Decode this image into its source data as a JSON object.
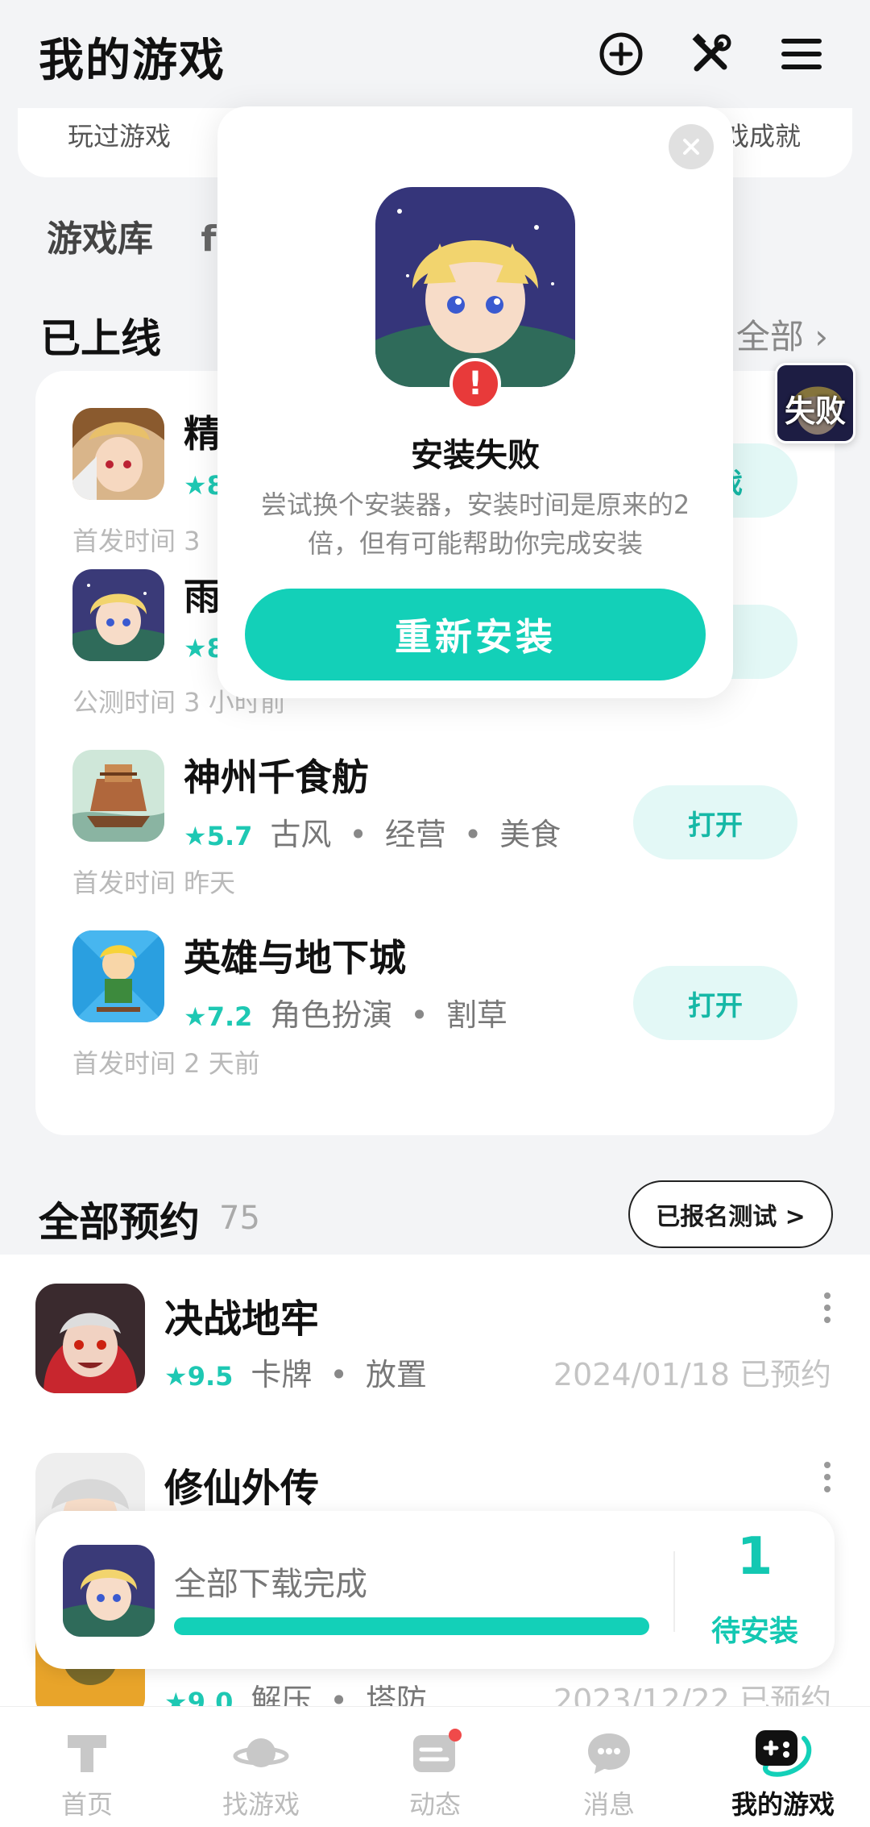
{
  "header": {
    "title": "我的游戏"
  },
  "stats": {
    "left": "玩过游戏",
    "right": "戏成就"
  },
  "tabs": {
    "label": "游戏库",
    "partial": "f"
  },
  "online": {
    "title": "已上线",
    "more": "全部",
    "games": [
      {
        "name": "精",
        "rating": "★8",
        "tags": [],
        "time": "首发时间 3 ",
        "button": "游戏"
      },
      {
        "name": "雨",
        "rating": "★8",
        "tags": [],
        "time": "公测时间 3 小时前",
        "button": "装"
      },
      {
        "name": "神州千食舫",
        "rating": "★5.7",
        "tags": [
          "古风",
          "经营",
          "美食"
        ],
        "time": "首发时间 昨天",
        "button": "打开"
      },
      {
        "name": "英雄与地下城",
        "rating": "★7.2",
        "tags": [
          "角色扮演",
          "割草"
        ],
        "time": "首发时间 2 天前",
        "button": "打开"
      }
    ]
  },
  "reserve": {
    "title": "全部预约",
    "count": "75",
    "button": "已报名测试 >",
    "items": [
      {
        "name": "决战地牢",
        "rating": "★9.5",
        "tags": [
          "卡牌",
          "放置"
        ],
        "date": "2024/01/18 已预约"
      },
      {
        "name": "修仙外传",
        "rating": "",
        "tags": [],
        "date": ""
      },
      {
        "name": "",
        "rating": "★9.0",
        "tags": [
          "解压",
          "塔防"
        ],
        "date": "2023/12/22 已预约"
      }
    ]
  },
  "download": {
    "text": "全部下载完成",
    "count": "1",
    "label": "待安装",
    "progress": 1.0
  },
  "popup": {
    "title": "安装失败",
    "desc": "尝试换个安装器，安装时间是原来的2倍，但有可能帮助你完成安装",
    "button": "重新安装",
    "warn": "!"
  },
  "fail_badge": "失败",
  "nav": [
    {
      "label": "首页",
      "icon": "home-icon"
    },
    {
      "label": "找游戏",
      "icon": "planet-icon"
    },
    {
      "label": "动态",
      "icon": "feed-icon"
    },
    {
      "label": "消息",
      "icon": "message-icon"
    },
    {
      "label": "我的游戏",
      "icon": "gamepad-icon"
    }
  ],
  "colors": {
    "accent": "#13d0b8",
    "warn": "#e83a3a"
  }
}
